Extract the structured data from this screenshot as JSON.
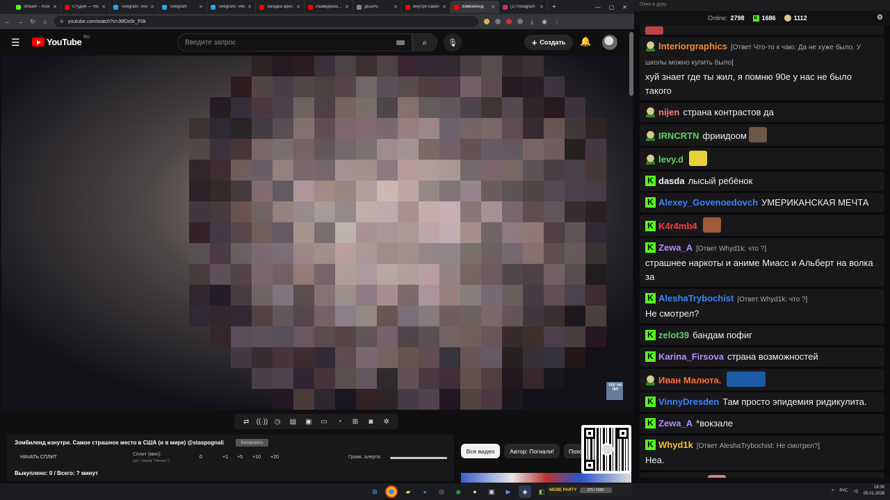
{
  "browser": {
    "tabs": [
      {
        "label": "Stream – Kick",
        "color": "#53fc18"
      },
      {
        "label": "Студия — YouTube",
        "color": "#ff0000"
      },
      {
        "label": "Telegram: View",
        "color": "#2aa3e6"
      },
      {
        "label": "Telegram",
        "color": "#2aa3e6"
      },
      {
        "label": "Telegram: View",
        "color": "#2aa3e6"
      },
      {
        "label": "Загадка арес…",
        "color": "#ff0000"
      },
      {
        "label": "Разведенка…",
        "color": "#ff0000"
      },
      {
        "label": "ДЕыРа",
        "color": "#888888"
      },
      {
        "label": "Внутри самого…",
        "color": "#ff0000"
      },
      {
        "label": "Зомбиленд",
        "color": "#ff0000",
        "active": true
      },
      {
        "label": "(1) Instagram",
        "color": "#d62976"
      }
    ],
    "url": "youtube.com/watch?v=J8fDo5r_F0k"
  },
  "youtube": {
    "logo_text": "YouTube",
    "region": "RU",
    "search_placeholder": "Введите запрос",
    "create_label": "Создать"
  },
  "video": {
    "watermark": "ПОГ НА ЛИ!"
  },
  "controls": {
    "icons": [
      "loop-icon",
      "live-icon",
      "watch-later-icon",
      "clapper-icon",
      "miniplayer-icon",
      "theater-icon",
      "speed-icon",
      "add-clip-icon",
      "screenshot-icon",
      "settings-icon"
    ],
    "glyphs": [
      "⇄",
      "((·))",
      "◷",
      "▤",
      "▣",
      "▭",
      "◔",
      "⊞",
      "◙",
      "✲"
    ]
  },
  "split_panel": {
    "title": "Зомбиленд изнутри. Самое страшное место в США (и в мире) @staspognali",
    "copy_label": "Копировать",
    "start_label": "НАЧАТЬ СПЛИТ",
    "split_label": "Сплит (мин):",
    "split_hint": "(уст. перед \"Начать\")",
    "values": [
      "0",
      "+1",
      "+5",
      "+10",
      "+20"
    ],
    "alert_label": "Громк. алерта:",
    "alert_volume": 1.0,
    "killed_text": "Выкуплено: 0 / Всего: ? минут"
  },
  "chips": {
    "all": "Все видео",
    "author": "Автор: Погнали!",
    "similar": "Похожие"
  },
  "chat": {
    "window_title": "Окно в дуру",
    "online_label": "Online:",
    "online_count": "2798",
    "kick_count": "1686",
    "sub_count": "1112",
    "messages": [
      {
        "badge": "face",
        "user": "Interiorgraphics",
        "color": "#f28b38",
        "reply": "[Ответ Что-то к чаю: Да не хуже было. У школы можно купить было]",
        "text": "хуй знает где ты жил, я помню 90е у нас не было такого"
      },
      {
        "badge": "face",
        "user": "nijen",
        "color": "#ff7a7a",
        "text": "страна контрастов да"
      },
      {
        "badge": "face",
        "user": "IRNCRTN",
        "color": "#5fd35f",
        "text": "фриидоом",
        "emote": "#6b5648"
      },
      {
        "badge": "face",
        "user": "levy.d",
        "color": "#5fd35f",
        "text": "",
        "emote": "#e7d23a"
      },
      {
        "badge": "k",
        "user": "dasda",
        "color": "#efeff1",
        "text": "лысый ребёнок"
      },
      {
        "badge": "k",
        "user": "Alexey_Govenoedovch",
        "color": "#3b82f6",
        "text": "УМЕРИКАНСКАЯ МЕЧТА"
      },
      {
        "badge": "k",
        "user": "K4r4mb4",
        "color": "#ff3b3b",
        "text": "",
        "emote": "#a05a3a"
      },
      {
        "badge": "k",
        "user": "Zewa_A",
        "color": "#b68cff",
        "reply": "[Ответ Whyd1k: что ?]",
        "text": "страшнее наркоты и аниме Миасс и Альберт на волка за"
      },
      {
        "badge": "k",
        "user": "AleshaTrybochist",
        "color": "#3b82f6",
        "reply": "[Ответ Whyd1k: что ?]",
        "text": "Не смотрел?"
      },
      {
        "badge": "k",
        "user": "zelot39",
        "color": "#5fd35f",
        "text": "бандам пофиг"
      },
      {
        "badge": "k",
        "user": "Karina_Firsova",
        "color": "#b68cff",
        "text": "страна возможностей"
      },
      {
        "badge": "face",
        "user": "Иван Малюта.",
        "color": "#ff6b3b",
        "text": "",
        "emote": "#1c5aa5",
        "emote_wide": true
      },
      {
        "badge": "k",
        "user": "VinnyDresden",
        "color": "#3b82f6",
        "text": "Там просто эпидемия ридикулита."
      },
      {
        "badge": "k",
        "user": "Zewa_A",
        "color": "#b68cff",
        "text": "*вокзале"
      },
      {
        "badge": "k",
        "user": "Whyd1k",
        "color": "#f2c12e",
        "reply": "[Ответ AleshaTrybochist: Не смотрел?]",
        "text": "Неа."
      },
      {
        "badge": "k",
        "user": "mvlkvxivn",
        "color": "#3b82f6",
        "text": "",
        "emote": "#c9867a"
      }
    ]
  },
  "taskbar": {
    "lang": "РУС",
    "time": "18:30",
    "date": "05.01.2026",
    "kick_widget_label": "MEME PARTY",
    "kick_widget_progress": "275 / 1500"
  }
}
